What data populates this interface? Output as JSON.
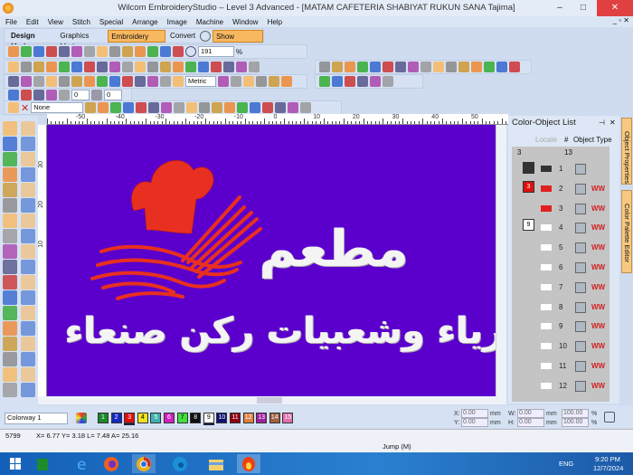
{
  "window": {
    "title": "Wilcom EmbroideryStudio – Level 3 Advanced - [MATAM CAFETERIA SHABIYAT RUKUN SANA         Tajima]",
    "minimize": "–",
    "maximize": "□",
    "close": "✕",
    "mdi_controls": "_ ▫ ✕"
  },
  "menu": [
    "File",
    "Edit",
    "View",
    "Stitch",
    "Special",
    "Arrange",
    "Image",
    "Machine",
    "Window",
    "Help"
  ],
  "design_mode": {
    "label": "Design Mode:",
    "graphics": "Graphics Mode",
    "embroidery": "Embroidery Mode",
    "convert": "Convert",
    "show_graphics": "Show Graphics"
  },
  "toolbar": {
    "zoom_value": "191",
    "zoom_unit": "%",
    "units": "Metric",
    "spin1": "0",
    "spin2": "0",
    "thread_none": "None"
  },
  "accent": "#f8b860",
  "rulers": {
    "h": [
      "-50",
      "-40",
      "-30",
      "-20",
      "-10",
      "0",
      "10",
      "20",
      "30",
      "40",
      "50"
    ],
    "v": [
      "30",
      "20",
      "10"
    ]
  },
  "design": {
    "title_text": "مطعم",
    "subtitle_text": "كفتيرياء وشعبيات ركن صنعاء",
    "background": "#5b00cc",
    "thread_red": "#e83020",
    "thread_white": "#f4f4f4"
  },
  "panel": {
    "title": "Color-Object List",
    "pin": "⊣",
    "close": "✕",
    "col_locate": "Locate",
    "col_num": "#",
    "col_type": "Object Type",
    "count_colors": "3",
    "count_objects": "13",
    "groups": [
      {
        "label": "3",
        "color": "#e01010"
      },
      {
        "label": "9",
        "color": "#ffffff"
      }
    ],
    "rows": [
      {
        "n": "1",
        "stitch": ""
      },
      {
        "n": "2",
        "stitch": "WW"
      },
      {
        "n": "3",
        "stitch": "WW"
      },
      {
        "n": "4",
        "stitch": "WW"
      },
      {
        "n": "5",
        "stitch": "WW"
      },
      {
        "n": "6",
        "stitch": "WW"
      },
      {
        "n": "7",
        "stitch": "WW"
      },
      {
        "n": "8",
        "stitch": "WW"
      },
      {
        "n": "9",
        "stitch": "WW"
      },
      {
        "n": "10",
        "stitch": "WW"
      },
      {
        "n": "11",
        "stitch": "WW"
      },
      {
        "n": "12",
        "stitch": "WW"
      }
    ]
  },
  "side_tabs": [
    "Object Properties",
    "Color Palette Editor"
  ],
  "colorway": {
    "name": "Colorway 1",
    "swatches": [
      {
        "n": "1",
        "c": "#1a8a2a"
      },
      {
        "n": "2",
        "c": "#1428c0"
      },
      {
        "n": "3",
        "c": "#e01010"
      },
      {
        "n": "4",
        "c": "#f0e020"
      },
      {
        "n": "5",
        "c": "#40b0b0"
      },
      {
        "n": "6",
        "c": "#d020c0"
      },
      {
        "n": "7",
        "c": "#40e040"
      },
      {
        "n": "8",
        "c": "#101010"
      },
      {
        "n": "9",
        "c": "#ffffff"
      },
      {
        "n": "10",
        "c": "#101070"
      },
      {
        "n": "11",
        "c": "#900010"
      },
      {
        "n": "12",
        "c": "#e08040"
      },
      {
        "n": "13",
        "c": "#a020a0"
      },
      {
        "n": "14",
        "c": "#a06040"
      },
      {
        "n": "15",
        "c": "#e070b0"
      }
    ]
  },
  "transform": {
    "x_label": "X:",
    "y_label": "Y:",
    "w_label": "W:",
    "h_label": "H:",
    "x": "0.00",
    "y": "0.00",
    "w": "0.00",
    "h": "0.00",
    "unit": "mm",
    "sx": "100.00",
    "sy": "100.00",
    "pct": "%"
  },
  "status": {
    "stitches": "5799",
    "coords": "X=  6.77 Y=   3.18 L=   7.48 A=  25.16",
    "mode": "Jump (M)"
  },
  "taskbar": {
    "lang": "ENG",
    "time": "9:20 PM",
    "date": "12/7/2024"
  }
}
